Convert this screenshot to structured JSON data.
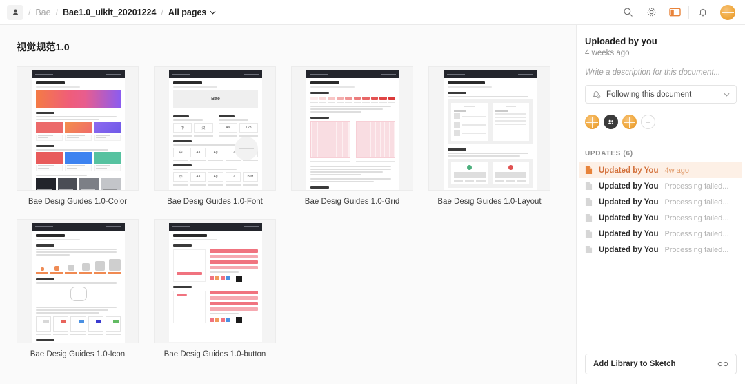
{
  "topbar": {
    "user_icon": "person-icon",
    "breadcrumb": [
      {
        "label": "Bae",
        "active": false
      },
      {
        "label": "Bae1.0_uikit_20201224",
        "active": true
      }
    ],
    "pages_selector": "All pages",
    "separator": "/",
    "icons": {
      "search": "search-icon",
      "settings": "gear-icon",
      "panel_toggle": "panel-toggle-icon",
      "notifications": "bell-icon",
      "avatar": "user-avatar"
    },
    "accent": "#E8833A"
  },
  "main": {
    "title": "视觉规范1.0",
    "cards": [
      {
        "caption": "Bae Desig Guides 1.0-Color",
        "kind": "color"
      },
      {
        "caption": "Bae Desig Guides 1.0-Font",
        "kind": "font"
      },
      {
        "caption": "Bae Desig Guides 1.0-Grid",
        "kind": "grid"
      },
      {
        "caption": "Bae Desig Guides 1.0-Layout",
        "kind": "layout"
      },
      {
        "caption": "Bae Desig Guides 1.0-Icon",
        "kind": "icon"
      },
      {
        "caption": "Bae Desig Guides 1.0-button",
        "kind": "button"
      }
    ],
    "thumb_palette": {
      "header_bar": "#23252C",
      "gradient": [
        "#F47B45",
        "#EF5D7A",
        "#8B5CF0"
      ],
      "swatch_red": "#E85B5B",
      "swatch_blue": "#3C82F0",
      "swatch_green": "#56C2A0",
      "grid_pink": "#F9DDE2",
      "button_red": "#F0737F",
      "icon_orange": "#EF8B55"
    }
  },
  "sidebar": {
    "title": "Uploaded by you",
    "subtitle": "4 weeks ago",
    "description_placeholder": "Write a description for this document...",
    "follow": {
      "icon": "bell-check-icon",
      "label": "Following this document",
      "chevron": "chevron-down-icon"
    },
    "collaborators": [
      {
        "type": "user-avatar"
      },
      {
        "type": "group-avatar"
      },
      {
        "type": "user-avatar"
      }
    ],
    "add_collaborator_label": "+",
    "updates_header": "UPDATES (6)",
    "updates": [
      {
        "label": "Updated by You",
        "meta": "4w ago",
        "active": true
      },
      {
        "label": "Updated by You",
        "meta": "Processing failed...",
        "active": false
      },
      {
        "label": "Updated by You",
        "meta": "Processing failed...",
        "active": false
      },
      {
        "label": "Updated by You",
        "meta": "Processing failed...",
        "active": false
      },
      {
        "label": "Updated by You",
        "meta": "Processing failed...",
        "active": false
      },
      {
        "label": "Updated by You",
        "meta": "Processing failed...",
        "active": false
      }
    ],
    "footer_button": {
      "label": "Add Library to Sketch",
      "icon": "link-icon"
    },
    "highlight_bg": "#FDF0E6",
    "highlight_text": "#D3703A"
  }
}
